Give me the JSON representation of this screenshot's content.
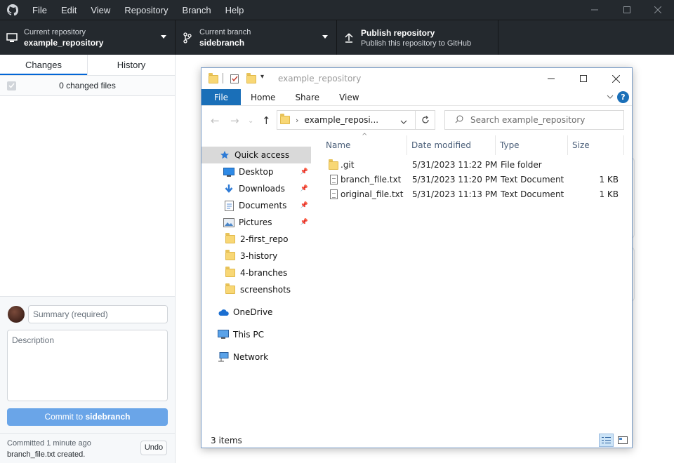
{
  "app": {
    "menu": [
      "File",
      "Edit",
      "View",
      "Repository",
      "Branch",
      "Help"
    ]
  },
  "toolbar": {
    "repo_label": "Current repository",
    "repo_value": "example_repository",
    "branch_label": "Current branch",
    "branch_value": "sidebranch",
    "publish_title": "Publish repository",
    "publish_desc": "Publish this repository to GitHub"
  },
  "sidebar": {
    "tabs": [
      "Changes",
      "History"
    ],
    "changed_files": "0 changed files",
    "summary_placeholder": "Summary (required)",
    "description_placeholder": "Description",
    "commit_prefix": "Commit to ",
    "commit_branch": "sidebranch",
    "last_commit_time": "Committed 1 minute ago",
    "last_commit_msg": "branch_file.txt created.",
    "undo": "Undo"
  },
  "explorer": {
    "title": "example_repository",
    "ribbon_tabs": [
      "File",
      "Home",
      "Share",
      "View"
    ],
    "help": "?",
    "address": "example_reposi...",
    "search_placeholder": "Search example_repository",
    "nav": [
      {
        "label": "Quick access",
        "icon": "star-icon"
      },
      {
        "label": "Desktop",
        "icon": "desktop-icon"
      },
      {
        "label": "Downloads",
        "icon": "download-icon"
      },
      {
        "label": "Documents",
        "icon": "documents-icon"
      },
      {
        "label": "Pictures",
        "icon": "pictures-icon"
      },
      {
        "label": "2-first_repo",
        "icon": "folder-icon"
      },
      {
        "label": "3-history",
        "icon": "folder-icon"
      },
      {
        "label": "4-branches",
        "icon": "folder-icon"
      },
      {
        "label": "screenshots",
        "icon": "folder-icon"
      },
      {
        "label": "OneDrive",
        "icon": "cloud-icon"
      },
      {
        "label": "This PC",
        "icon": "computer-icon"
      },
      {
        "label": "Network",
        "icon": "network-icon"
      }
    ],
    "columns": [
      "Name",
      "Date modified",
      "Type",
      "Size"
    ],
    "files": [
      {
        "name": ".git",
        "date": "5/31/2023 11:22 PM",
        "type": "File folder",
        "size": ""
      },
      {
        "name": "branch_file.txt",
        "date": "5/31/2023 11:20 PM",
        "type": "Text Document",
        "size": "1 KB"
      },
      {
        "name": "original_file.txt",
        "date": "5/31/2023 11:13 PM",
        "type": "Text Document",
        "size": "1 KB"
      }
    ],
    "item_count": "3 items"
  }
}
